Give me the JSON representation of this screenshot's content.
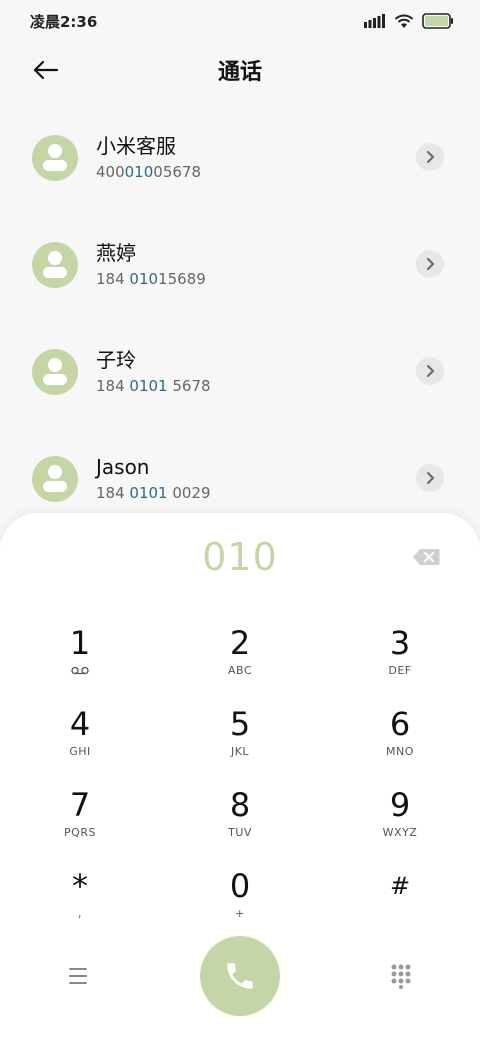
{
  "status_bar": {
    "time": "凌晨2:36",
    "icons": [
      "signal-icon",
      "wifi-icon",
      "battery-icon"
    ]
  },
  "header": {
    "title": "通话",
    "back_icon": "back-arrow-icon"
  },
  "contacts": [
    {
      "name": "小米客服",
      "number_prefix": "400",
      "number_match": "010",
      "number_suffix": "05678"
    },
    {
      "name": "燕婷",
      "number_prefix": "184 ",
      "number_match": "010",
      "number_suffix": "15689"
    },
    {
      "name": "子玲",
      "number_prefix": "184 ",
      "number_match": "0101",
      "number_suffix": " 5678"
    },
    {
      "name": "Jason",
      "number_prefix": "184 ",
      "number_match": "0101",
      "number_suffix": " 0029"
    }
  ],
  "dialpad": {
    "dialed": "010",
    "keys": [
      {
        "digit": "1",
        "letters": ""
      },
      {
        "digit": "2",
        "letters": "ABC"
      },
      {
        "digit": "3",
        "letters": "DEF"
      },
      {
        "digit": "4",
        "letters": "GHI"
      },
      {
        "digit": "5",
        "letters": "JKL"
      },
      {
        "digit": "6",
        "letters": "MNO"
      },
      {
        "digit": "7",
        "letters": "PQRS"
      },
      {
        "digit": "8",
        "letters": "TUV"
      },
      {
        "digit": "9",
        "letters": "WXYZ"
      },
      {
        "digit": "*",
        "letters": ","
      },
      {
        "digit": "0",
        "letters": "+"
      },
      {
        "digit": "#",
        "letters": ""
      }
    ]
  },
  "colors": {
    "accent": "#c5d6a6",
    "match_highlight": "#2f6a80",
    "background": "#f7f7f7"
  }
}
